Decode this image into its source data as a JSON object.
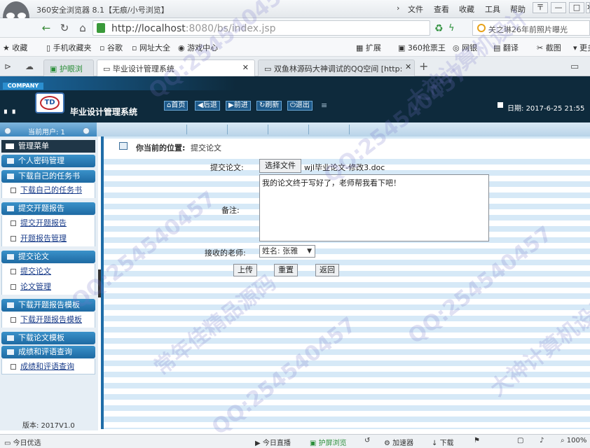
{
  "window": {
    "app_title": "360安全浏览器 8.1【无痕/小号浏览】",
    "menus": [
      "文件",
      "查看",
      "收藏",
      "工具",
      "帮助"
    ],
    "controls": [
      "〒",
      "—",
      "□",
      "✕"
    ]
  },
  "address_bar": {
    "url_host": "http://localhost",
    "url_rest": ":8080/bs/index.jsp",
    "search_text": "关之琳26年前照片曝光"
  },
  "bookmarks": {
    "left": [
      "收藏",
      "手机收藏夹",
      "谷歌",
      "网址大全",
      "游戏中心"
    ],
    "right": [
      "扩展",
      "360抢票王",
      "网银",
      "翻译",
      "截图",
      "更多"
    ]
  },
  "tabs": [
    {
      "label": "护眼浏览",
      "active": false
    },
    {
      "label": "毕业设计管理系统",
      "active": true
    },
    {
      "label": "双鱼林源码大神调试的QQ空间 [http:",
      "active": false
    }
  ],
  "header": {
    "company": "COMPANY",
    "logo_text": "TD",
    "system_title": "毕业设计管理系统",
    "nav": [
      "首页",
      "后退",
      "前进",
      "刷新",
      "退出"
    ],
    "date_label": "日期:",
    "date_value": "2017-6-25 21:55"
  },
  "subbar": {
    "current_user": "当前用户: 1"
  },
  "sidebar": {
    "menu_title": "管理菜单",
    "groups": [
      {
        "title": "个人密码管理",
        "items": []
      },
      {
        "title": "下载自己的任务书",
        "items": [
          "下载自己的任务书"
        ]
      },
      {
        "title": "提交开题报告",
        "items": [
          "提交开题报告",
          "开题报告管理"
        ]
      },
      {
        "title": "提交论文",
        "items": [
          "提交论文",
          "论文管理"
        ]
      },
      {
        "title": "下载开题报告模板",
        "items": [
          "下载开题报告模板"
        ]
      },
      {
        "title": "下载论文模板",
        "items": []
      },
      {
        "title": "成绩和评语查询",
        "items": [
          "成绩和评语查询"
        ]
      }
    ],
    "version": "版本: 2017V1.0"
  },
  "main": {
    "crumb_prefix": "你当前的位置:",
    "crumb_page": "提交论文",
    "label_file": "提交论文:",
    "file_button": "选择文件",
    "file_name": "wjl毕业论文-修改3.doc",
    "label_note": "备注:",
    "note_value": "我的论文终于写好了，老师帮我看下吧！",
    "label_teacher": "接收的老师:",
    "teacher_selected": "姓名: 张雅",
    "buttons": [
      "上传",
      "重置",
      "返回"
    ]
  },
  "statusbar": {
    "left": "今日优选",
    "items": [
      "今日直播",
      "护屏浏览",
      "加速器",
      "下载",
      "100%"
    ]
  },
  "watermarks": [
    "QQ:254540457",
    "大神计算机设计",
    "常年佳精品源码"
  ],
  "colors": {
    "header_bg": "#0e2a3c",
    "sidebar_head": "#1e6aa3",
    "main_stripe": "#d6e9f7",
    "accent_green": "#3a8a3a"
  }
}
